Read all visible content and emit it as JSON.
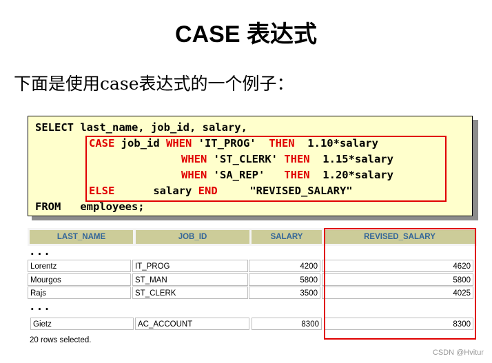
{
  "title": "CASE 表达式",
  "intro": "下面是使用case表达式的一个例子：",
  "code": {
    "line1": "SELECT last_name, job_id, salary,",
    "case_kw": "CASE",
    "job_id": " job_id ",
    "when_kw": "WHEN",
    "then_kw": "THEN",
    "else_kw": "ELSE",
    "end_kw": "END",
    "from_kw": "FROM",
    "when1_val": " 'IT_PROG'  ",
    "then1_val": "  1.10*salary",
    "when2_val": " 'ST_CLERK' ",
    "then2_val": "  1.15*salary",
    "when3_val": " 'SA_REP'   ",
    "then3_val": "  1.20*salary",
    "else_val": "      salary ",
    "end_alias": "     \"REVISED_SALARY\"",
    "from_val": "   employees;"
  },
  "table": {
    "headers": [
      "LAST_NAME",
      "JOB_ID",
      "SALARY",
      "REVISED_SALARY"
    ],
    "ellipsis": "...",
    "rows": [
      [
        "Lorentz",
        "IT_PROG",
        "4200",
        "4620"
      ],
      [
        "Mourgos",
        "ST_MAN",
        "5800",
        "5800"
      ],
      [
        "Rajs",
        "ST_CLERK",
        "3500",
        "4025"
      ]
    ],
    "last_row": [
      "Gietz",
      "AC_ACCOUNT",
      "8300",
      "8300"
    ],
    "footer": "20 rows selected."
  },
  "watermark": "CSDN @Hvitur",
  "colors": {
    "keyword": "#e00000",
    "code_bg": "#ffffcc",
    "header_bg": "#cccc99",
    "header_text": "#336699"
  }
}
